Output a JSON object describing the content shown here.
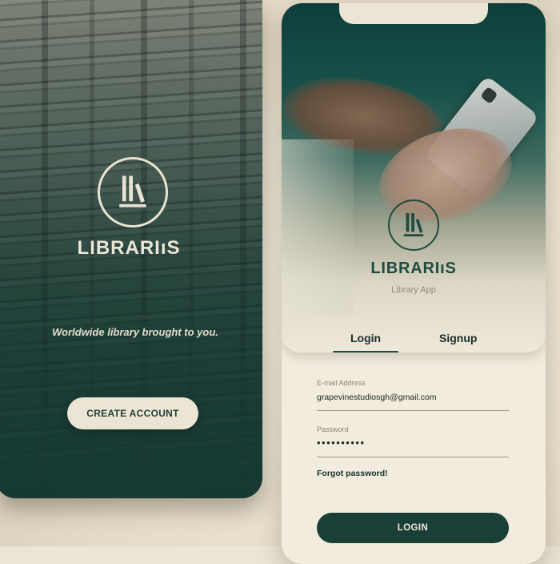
{
  "splash": {
    "brand": "LIBRARIıS",
    "tagline": "Worldwide library brought to you.",
    "create_account_label": "CREATE ACCOUNT",
    "logo_icon": "book-stack-logo-icon"
  },
  "login_screen": {
    "brand": "LIBRARIıS",
    "subtitle": "Library App",
    "logo_icon": "book-stack-logo-icon",
    "tabs": [
      {
        "label": "Login",
        "active": true
      },
      {
        "label": "Signup",
        "active": false
      }
    ],
    "email": {
      "label": "E-mail Address",
      "value": "grapevinestudiosgh@gmail.com"
    },
    "password": {
      "label": "Password",
      "value": "••••••••••"
    },
    "forgot_label": "Forgot password!",
    "login_label": "LOGIN"
  },
  "colors": {
    "primary": "#1f4a40",
    "cream": "#ece5d5",
    "button_dark": "#1a3f37"
  }
}
